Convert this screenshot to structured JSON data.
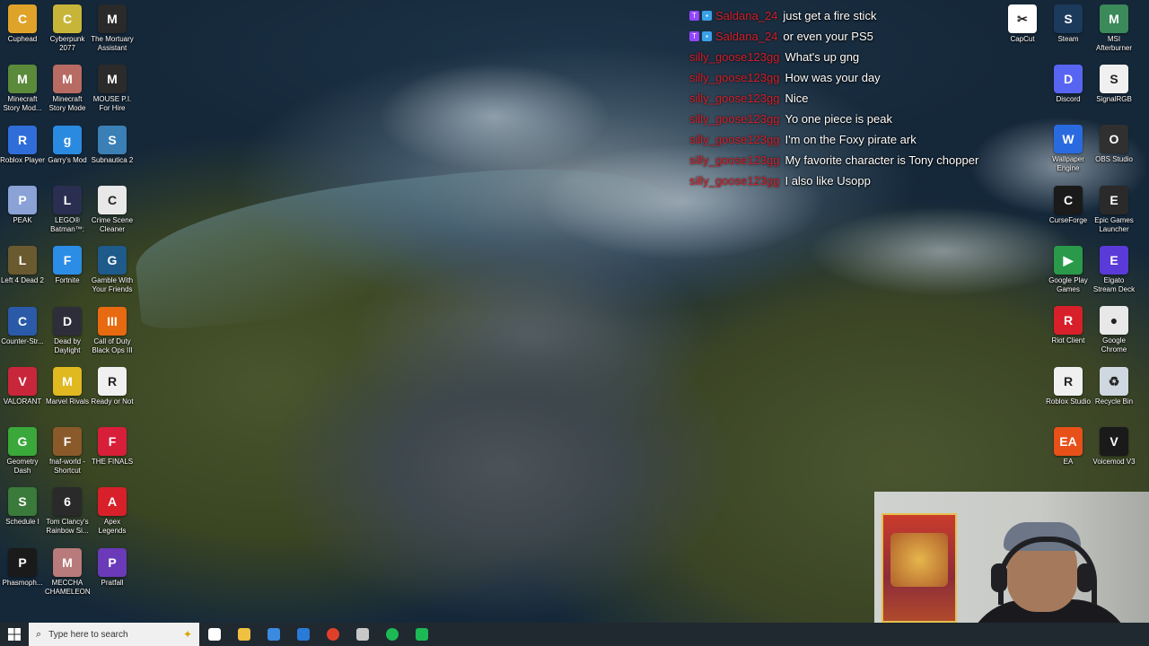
{
  "desktop": {
    "icons_left": [
      {
        "label": "Cuphead",
        "icon": "cuphead-icon",
        "color": "#e0a32a",
        "glyph": "C"
      },
      {
        "label": "Cyberpunk 2077",
        "icon": "cyberpunk-icon",
        "color": "#c7b53a",
        "glyph": "C"
      },
      {
        "label": "The Mortuary Assistant",
        "icon": "mortuary-assistant-icon",
        "color": "#2a2a2a",
        "glyph": "M"
      },
      {
        "label": "Minecraft Story Mod...",
        "icon": "minecraft-story-mode-icon",
        "color": "#5a8a3a",
        "glyph": "M"
      },
      {
        "label": "Minecraft Story Mode",
        "icon": "minecraft-story-mode-2-icon",
        "color": "#b86b63",
        "glyph": "M"
      },
      {
        "label": "MOUSE P.I. For Hire",
        "icon": "mouse-pi-icon",
        "color": "#2b2b2b",
        "glyph": "M"
      },
      {
        "label": "Roblox Player",
        "icon": "roblox-player-icon",
        "color": "#2f6ed8",
        "glyph": "R"
      },
      {
        "label": "Garry's Mod",
        "icon": "garrys-mod-icon",
        "color": "#2a8ae0",
        "glyph": "g"
      },
      {
        "label": "Subnautica 2",
        "icon": "subnautica-icon",
        "color": "#3a7fb5",
        "glyph": "S"
      },
      {
        "label": "PEAK",
        "icon": "peak-icon",
        "color": "#8aa2d6",
        "glyph": "P"
      },
      {
        "label": "LEGO® Batman™: L...",
        "icon": "lego-batman-icon",
        "color": "#2a2f52",
        "glyph": "L"
      },
      {
        "label": "Crime Scene Cleaner",
        "icon": "crime-scene-cleaner-icon",
        "color": "#e8e8e8",
        "glyph": "C"
      },
      {
        "label": "Left 4 Dead 2",
        "icon": "left4dead-icon",
        "color": "#6a5a30",
        "glyph": "L"
      },
      {
        "label": "Fortnite",
        "icon": "fortnite-icon",
        "color": "#2c8de6",
        "glyph": "F"
      },
      {
        "label": "Gamble With Your Friends",
        "icon": "gamble-icon",
        "color": "#1e5a8a",
        "glyph": "G"
      },
      {
        "label": "Counter-Str...",
        "icon": "counter-strike-icon",
        "color": "#2a5aa8",
        "glyph": "C"
      },
      {
        "label": "Dead by Daylight",
        "icon": "dead-by-daylight-icon",
        "color": "#2e2e3a",
        "glyph": "D"
      },
      {
        "label": "Call of Duty Black Ops III",
        "icon": "call-of-duty-icon",
        "color": "#e86a10",
        "glyph": "III"
      },
      {
        "label": "VALORANT",
        "icon": "valorant-icon",
        "color": "#c8263a",
        "glyph": "V"
      },
      {
        "label": "Marvel Rivals",
        "icon": "marvel-rivals-icon",
        "color": "#e0b820",
        "glyph": "M"
      },
      {
        "label": "Ready or Not",
        "icon": "ready-or-not-icon",
        "color": "#f0f0f0",
        "glyph": "R"
      },
      {
        "label": "Geometry Dash",
        "icon": "geometry-dash-icon",
        "color": "#3aa83a",
        "glyph": "G"
      },
      {
        "label": "fnaf-world - Shortcut",
        "icon": "fnaf-world-icon",
        "color": "#8a5a2a",
        "glyph": "F"
      },
      {
        "label": "THE FINALS",
        "icon": "the-finals-icon",
        "color": "#d81f3a",
        "glyph": "F"
      },
      {
        "label": "Schedule I",
        "icon": "schedule-one-icon",
        "color": "#3a7a3a",
        "glyph": "S"
      },
      {
        "label": "Tom Clancy's Rainbow Si...",
        "icon": "rainbow-six-icon",
        "color": "#2a2a2a",
        "glyph": "6"
      },
      {
        "label": "Apex Legends",
        "icon": "apex-legends-icon",
        "color": "#d8202a",
        "glyph": "A"
      },
      {
        "label": "Phasmoph...",
        "icon": "phasmophobia-icon",
        "color": "#1a1a1a",
        "glyph": "P"
      },
      {
        "label": "MECCHA CHAMELEON",
        "icon": "meccha-chameleon-icon",
        "color": "#b87a7a",
        "glyph": "M"
      },
      {
        "label": "Pratfall",
        "icon": "pratfall-icon",
        "color": "#6a3ab8",
        "glyph": "P"
      }
    ],
    "icons_right": [
      {
        "label": "CapCut",
        "icon": "capcut-icon",
        "color": "#ffffff",
        "glyph": "✂"
      },
      {
        "label": "Steam",
        "icon": "steam-icon",
        "color": "#1b3a5c",
        "glyph": "S"
      },
      {
        "label": "MSI Afterburner",
        "icon": "msi-afterburner-icon",
        "color": "#3a8a5a",
        "glyph": "M"
      },
      {
        "label": "Discord",
        "icon": "discord-icon",
        "color": "#5865f2",
        "glyph": "D"
      },
      {
        "label": "SignalRGB",
        "icon": "signalrgb-icon",
        "color": "#f0f0f0",
        "glyph": "S"
      },
      {
        "label": "Wallpaper Engine",
        "icon": "wallpaper-engine-icon",
        "color": "#2a6ae0",
        "glyph": "W"
      },
      {
        "label": "OBS Studio",
        "icon": "obs-studio-icon",
        "color": "#303030",
        "glyph": "O"
      },
      {
        "label": "CurseForge",
        "icon": "curseforge-icon",
        "color": "#1a1a1a",
        "glyph": "C"
      },
      {
        "label": "Epic Games Launcher",
        "icon": "epic-games-icon",
        "color": "#2a2a2a",
        "glyph": "E"
      },
      {
        "label": "Google Play Games",
        "icon": "google-play-games-icon",
        "color": "#2a9a4a",
        "glyph": "▶"
      },
      {
        "label": "Elgato Stream Deck",
        "icon": "stream-deck-icon",
        "color": "#5a3ad8",
        "glyph": "E"
      },
      {
        "label": "Riot Client",
        "icon": "riot-client-icon",
        "color": "#d8202a",
        "glyph": "R"
      },
      {
        "label": "Google Chrome",
        "icon": "chrome-icon",
        "color": "#e8e8e8",
        "glyph": "●"
      },
      {
        "label": "Roblox Studio",
        "icon": "roblox-studio-icon",
        "color": "#f0f0f0",
        "glyph": "R"
      },
      {
        "label": "Recycle Bin",
        "icon": "recycle-bin-icon",
        "color": "#cfd8e0",
        "glyph": "♻"
      },
      {
        "label": "EA",
        "icon": "ea-icon",
        "color": "#e8501a",
        "glyph": "EA"
      },
      {
        "label": "Voicemod V3",
        "icon": "voicemod-icon",
        "color": "#1a1a1a",
        "glyph": "V"
      }
    ]
  },
  "chat": {
    "messages": [
      {
        "user": "Saldana_24",
        "badges": true,
        "text": "just get a fire stick"
      },
      {
        "user": "Saldana_24",
        "badges": true,
        "text": "or even your PS5"
      },
      {
        "user": "silly_goose123gg",
        "badges": false,
        "text": "What's up gng"
      },
      {
        "user": "silly_goose123gg",
        "badges": false,
        "text": "How was your day"
      },
      {
        "user": "silly_goose123gg",
        "badges": false,
        "text": "Nice"
      },
      {
        "user": "silly_goose123gg",
        "badges": false,
        "text": "Yo one piece is peak"
      },
      {
        "user": "silly_goose123gg",
        "badges": false,
        "text": "I'm on the Foxy pirate ark"
      },
      {
        "user": "silly_goose123gg",
        "badges": false,
        "text": "My favorite character is Tony chopper"
      },
      {
        "user": "silly_goose123gg",
        "badges": false,
        "text": "I also like Usopp"
      }
    ],
    "username_color": "#d1202b"
  },
  "taskbar": {
    "search_placeholder": "Type here to search",
    "pinned": [
      {
        "name": "task-view-icon",
        "color": "#ffffff"
      },
      {
        "name": "file-explorer-icon",
        "color": "#f0c040"
      },
      {
        "name": "microsoft-store-icon",
        "color": "#3a8ae0"
      },
      {
        "name": "edge-icon",
        "color": "#2a7ad8"
      },
      {
        "name": "chrome-taskbar-icon",
        "color": "#e0402a"
      },
      {
        "name": "settings-taskbar-icon",
        "color": "#c8c8c8"
      },
      {
        "name": "spotify-icon",
        "color": "#1db954"
      },
      {
        "name": "streaming-app-icon",
        "color": "#1db954"
      }
    ]
  }
}
